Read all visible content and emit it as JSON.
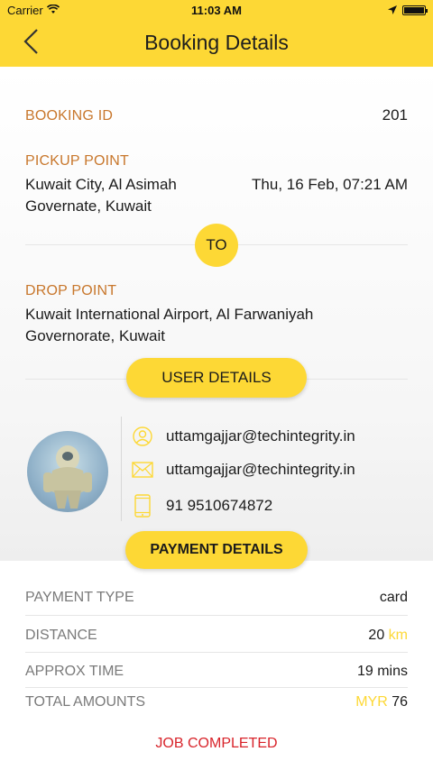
{
  "status_bar": {
    "carrier": "Carrier",
    "time": "11:03 AM"
  },
  "nav": {
    "title": "Booking Details"
  },
  "booking": {
    "id_label": "BOOKING ID",
    "id_value": "201",
    "pickup_label": "PICKUP POINT",
    "pickup_line1": "Kuwait City, Al Asimah",
    "pickup_line2": "Governate, Kuwait",
    "pickup_datetime": "Thu, 16 Feb, 07:21 AM",
    "to_label": "TO",
    "drop_label": "DROP POINT",
    "drop_line1": "Kuwait International Airport, Al Farwaniyah",
    "drop_line2": "Governorate, Kuwait"
  },
  "user_details": {
    "button_label": "USER DETAILS",
    "username": "uttamgajjar@techintegrity.in",
    "email": "uttamgajjar@techintegrity.in",
    "phone": "91 9510674872"
  },
  "payment": {
    "button_label": "PAYMENT DETAILS",
    "rows": [
      {
        "label": "PAYMENT TYPE",
        "value": "card"
      },
      {
        "label": "DISTANCE",
        "value": "20",
        "unit": "km"
      },
      {
        "label": "APPROX TIME",
        "value": "19 mins"
      },
      {
        "label": "TOTAL AMOUNTS",
        "currency": "MYR",
        "value": "76"
      }
    ],
    "status": "JOB COMPLETED"
  },
  "colors": {
    "accent": "#fdd835",
    "label_orange": "#c8772c",
    "status_red": "#d8232a"
  },
  "icons": {
    "back": "chevron-left-icon",
    "user": "user-circle-icon",
    "email": "envelope-icon",
    "phone": "mobile-phone-icon"
  }
}
